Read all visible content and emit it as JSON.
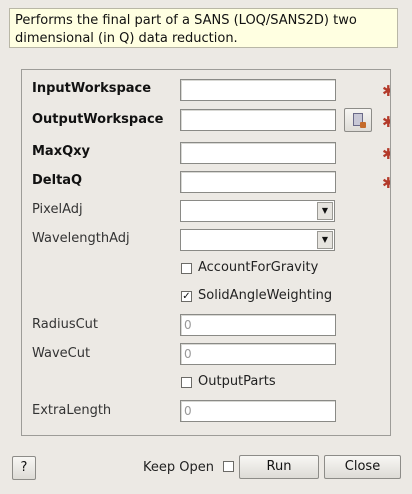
{
  "description": "Performs the final part of a SANS (LOQ/SANS2D) two dimensional (in Q) data reduction.",
  "properties": {
    "input_workspace": {
      "label": "InputWorkspace",
      "value": "",
      "required": true
    },
    "output_workspace": {
      "label": "OutputWorkspace",
      "value": "",
      "required": true
    },
    "max_qxy": {
      "label": "MaxQxy",
      "value": "",
      "required": true
    },
    "delta_q": {
      "label": "DeltaQ",
      "value": "",
      "required": true
    },
    "pixel_adj": {
      "label": "PixelAdj",
      "value": ""
    },
    "wavelength_adj": {
      "label": "WavelengthAdj",
      "value": ""
    },
    "radius_cut": {
      "label": "RadiusCut",
      "placeholder": "0"
    },
    "wave_cut": {
      "label": "WaveCut",
      "placeholder": "0"
    },
    "extra_length": {
      "label": "ExtraLength",
      "placeholder": "0"
    }
  },
  "checkboxes": {
    "account_for_gravity": {
      "label": "AccountForGravity",
      "checked": false
    },
    "solid_angle_weighting": {
      "label": "SolidAngleWeighting",
      "checked": true
    },
    "output_parts": {
      "label": "OutputParts",
      "checked": false
    }
  },
  "footer": {
    "help_label": "?",
    "keep_open_label": "Keep Open",
    "keep_open_checked": false,
    "run_label": "Run",
    "close_label": "Close"
  },
  "icons": {
    "required": "required-star-icon",
    "browse": "browse-workspace-icon",
    "dropdown": "chevron-down-icon"
  },
  "colors": {
    "required_star": "#b33a2a",
    "description_bg": "#ffffe1",
    "window_bg": "#ece9e4"
  }
}
